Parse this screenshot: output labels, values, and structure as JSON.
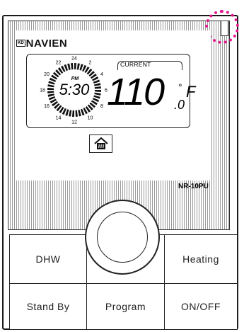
{
  "brand": {
    "prefix": "KD",
    "name": "NAVIEN"
  },
  "model": "NR-10PU",
  "lcd": {
    "current_label": "CURRENT",
    "time": "5:30",
    "ampm": "PM",
    "temperature": "110",
    "temperature_decimal": ".0",
    "unit": "F",
    "clock_hours": [
      "2",
      "4",
      "6",
      "8",
      "10",
      "12",
      "14",
      "16",
      "18",
      "20",
      "22",
      "24"
    ]
  },
  "buttons": {
    "dhw": "DHW",
    "heating": "Heating",
    "standby": "Stand By",
    "program": "Program",
    "onoff": "ON/OFF"
  },
  "colors": {
    "highlight": "#e4148c"
  }
}
